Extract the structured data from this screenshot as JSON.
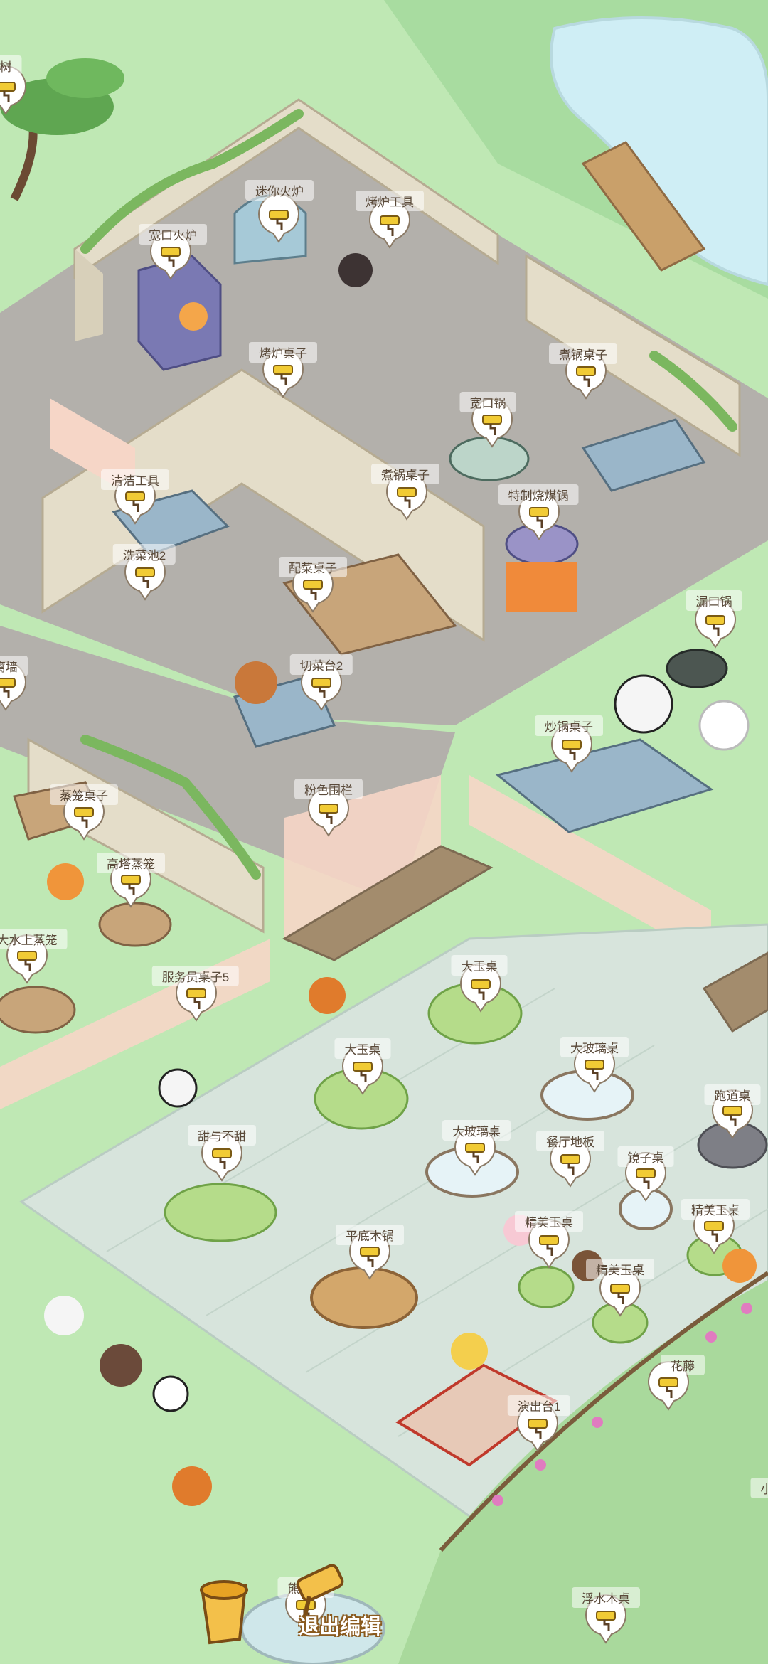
{
  "labels": [
    "树",
    "迷你火炉",
    "烤炉工具",
    "宽口火炉",
    "烤炉桌子",
    "煮锅桌子",
    "宽口锅",
    "清洁工具",
    "煮锅桌子",
    "特制烧煤锅",
    "洗菜池2",
    "配菜桌子",
    "漏口锅",
    "篱墙",
    "切菜台2",
    "炒锅桌子",
    "蒸笼桌子",
    "粉色围栏",
    "高塔蒸笼",
    "大水上蒸笼",
    "大玉桌",
    "服务员桌子5",
    "大玉桌",
    "大玻璃桌",
    "跑道桌",
    "甜与不甜",
    "大玻璃桌",
    "餐厅地板",
    "镜子桌",
    "精美玉桌",
    "精美玉桌",
    "平底木锅",
    "精美玉桌",
    "花藤",
    "演出台1",
    "熊猫嘻",
    "浮水木桌",
    "小"
  ],
  "exit_button": "退出编辑",
  "colors": {
    "grass": "#bfe8b4",
    "stone_floor": "#b3b0ab",
    "plaza": "#d7e4dc",
    "wall": "#e4ddc9",
    "pond": "#cfeef5",
    "pin_yellow": "#f1cb35"
  }
}
